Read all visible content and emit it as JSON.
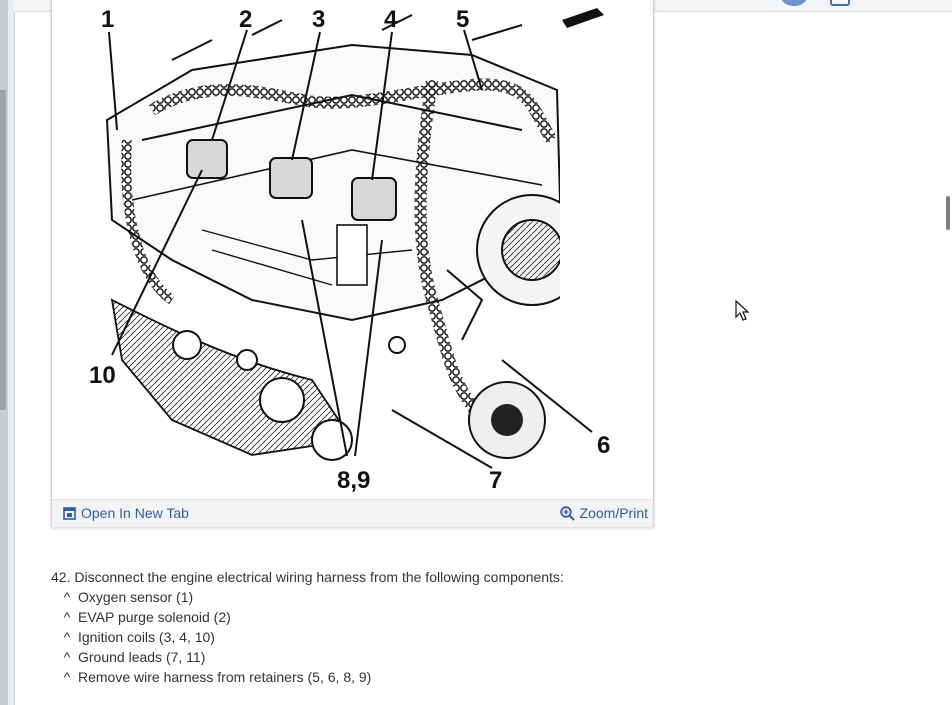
{
  "figure": {
    "callouts": [
      "1",
      "2",
      "3",
      "4",
      "5",
      "6",
      "7",
      "8,9",
      "10"
    ],
    "open_new_tab_label": "Open In New Tab",
    "zoom_print_label": "Zoom/Print"
  },
  "instructions": {
    "step": "42. Disconnect the engine electrical wiring harness from the following components:",
    "bullet_marker": "^",
    "items": [
      "Oxygen sensor (1)",
      "EVAP purge solenoid (2)",
      "Ignition coils (3, 4, 10)",
      "Ground leads (7, 11)",
      "Remove wire harness from retainers (5, 6, 8, 9)"
    ]
  },
  "icons": {
    "open_tab": "open-in-new-tab-icon",
    "zoom": "magnifier-plus-icon",
    "cursor": "mouse-pointer-icon"
  },
  "colors": {
    "link": "#2d5fa0",
    "text": "#333333"
  }
}
